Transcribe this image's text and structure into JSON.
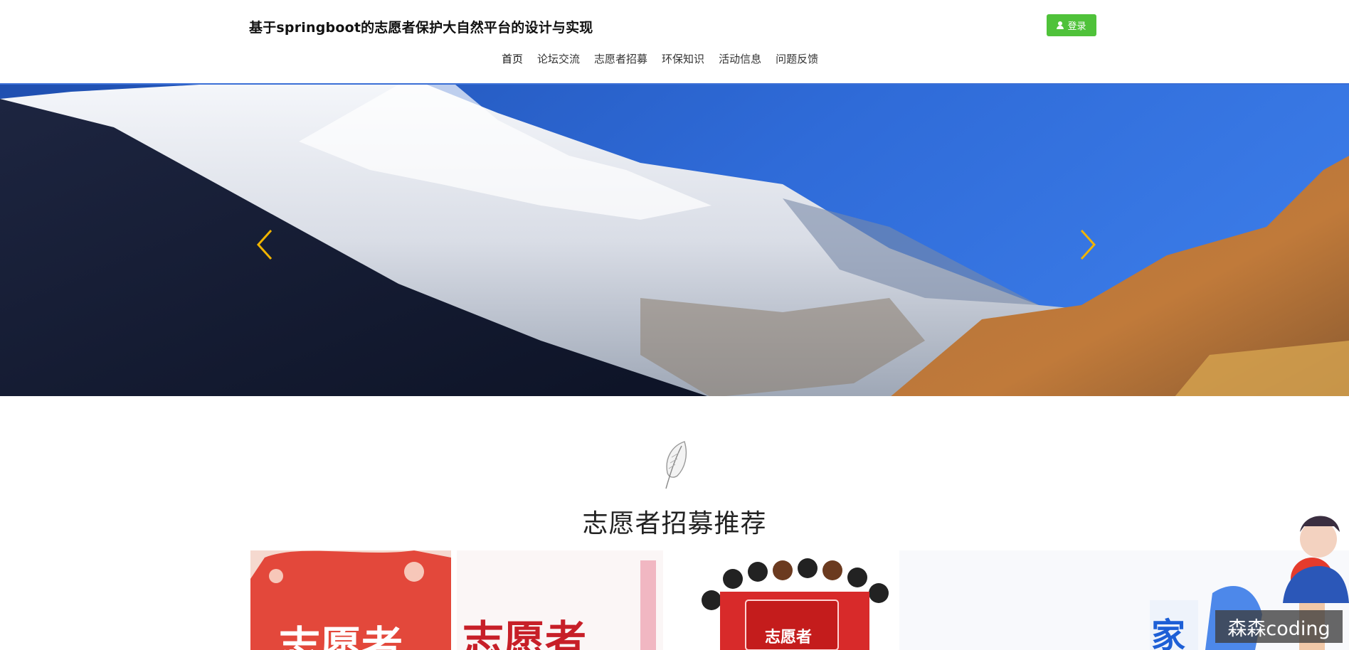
{
  "header": {
    "site_title": "基于springboot的志愿者保护大自然平台的设计与实现",
    "login_label": "登录"
  },
  "nav": {
    "items": [
      {
        "label": "首页",
        "active": true
      },
      {
        "label": "论坛交流",
        "active": false
      },
      {
        "label": "志愿者招募",
        "active": false
      },
      {
        "label": "环保知识",
        "active": false
      },
      {
        "label": "活动信息",
        "active": false
      },
      {
        "label": "问题反馈",
        "active": false
      }
    ]
  },
  "banner": {
    "prev_icon": "chevron-left-icon",
    "next_icon": "chevron-right-icon",
    "arrow_color": "#f0b400",
    "sky_color": "#2f6bd8"
  },
  "recommend": {
    "title": "志愿者招募推荐",
    "icon": "feather-icon",
    "cards": [
      {
        "text": "志愿者"
      },
      {
        "text": "志愿者"
      },
      {
        "text": "志愿者"
      },
      {
        "text": "家"
      }
    ]
  },
  "watermark": "森森coding",
  "colors": {
    "accent_green": "#4fc23a",
    "nav_highlight": "#f5b800"
  }
}
